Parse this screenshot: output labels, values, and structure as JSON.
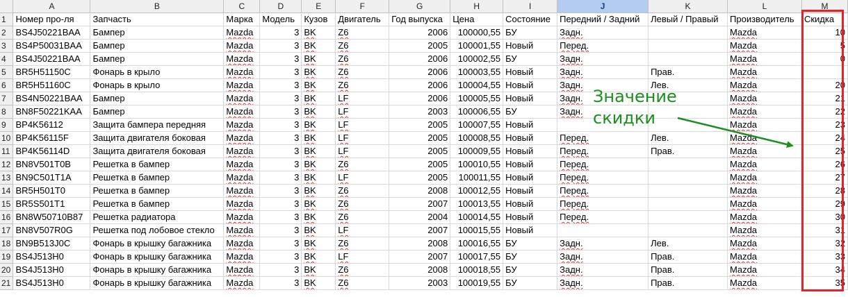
{
  "sheet": {
    "column_letters": [
      "A",
      "B",
      "C",
      "D",
      "E",
      "F",
      "G",
      "H",
      "I",
      "J",
      "K",
      "L",
      "M"
    ],
    "selected_column": "J",
    "headers": [
      "Номер про-ля",
      "Запчасть",
      "Марка",
      "Модель",
      "Кузов",
      "Двигатель",
      "Год выпуска",
      "Цена",
      "Состояние",
      "Передний / Задний",
      "Левый / Правый",
      "Производитель",
      "Скидка"
    ],
    "rows": [
      [
        "BS4J50221BAA",
        "Бампер",
        "Mazda",
        "3",
        "BK",
        "Z6",
        "2006",
        "100000,55",
        "БУ",
        "Задн.",
        "",
        "Mazda",
        "10"
      ],
      [
        "BS4P50031BAA",
        "Бампер",
        "Mazda",
        "3",
        "BK",
        "Z6",
        "2005",
        "100001,55",
        "Новый",
        "Перед.",
        "",
        "Mazda",
        "5"
      ],
      [
        "BS4J50221BAA",
        "Бампер",
        "Mazda",
        "3",
        "BK",
        "Z6",
        "2006",
        "100002,55",
        "БУ",
        "Задн.",
        "",
        "Mazda",
        "0"
      ],
      [
        "BR5H51150C",
        "Фонарь в крыло",
        "Mazda",
        "3",
        "BK",
        "Z6",
        "2006",
        "100003,55",
        "Новый",
        "Задн.",
        "Прав.",
        "Mazda",
        ""
      ],
      [
        "BR5H51160C",
        "Фонарь в крыло",
        "Mazda",
        "3",
        "BK",
        "Z6",
        "2006",
        "100004,55",
        "Новый",
        "Задн.",
        "Лев.",
        "Mazda",
        "20"
      ],
      [
        "BS4N50221BAA",
        "Бампер",
        "Mazda",
        "3",
        "BK",
        "LF",
        "2006",
        "100005,55",
        "Новый",
        "Задн.",
        "",
        "Mazda",
        "21"
      ],
      [
        "BN8F50221KAA",
        "Бампер",
        "Mazda",
        "3",
        "BK",
        "LF",
        "2003",
        "100006,55",
        "БУ",
        "Задн.",
        "",
        "Mazda",
        "22"
      ],
      [
        "BP4K56112",
        "Защита бампера передняя",
        "Mazda",
        "3",
        "BK",
        "LF",
        "2005",
        "100007,55",
        "Новый",
        "",
        "",
        "Mazda",
        "23"
      ],
      [
        "BP4K56115F",
        "Защита двигателя боковая",
        "Mazda",
        "3",
        "BK",
        "LF",
        "2005",
        "100008,55",
        "Новый",
        "Перед.",
        "Лев.",
        "Mazda",
        "24"
      ],
      [
        "BP4K56114D",
        "Защита двигателя боковая",
        "Mazda",
        "3",
        "BK",
        "LF",
        "2005",
        "100009,55",
        "Новый",
        "Перед.",
        "Прав.",
        "Mazda",
        "25"
      ],
      [
        "BN8V501T0B",
        "Решетка в бампер",
        "Mazda",
        "3",
        "BK",
        "Z6",
        "2005",
        "100010,55",
        "Новый",
        "Перед.",
        "",
        "Mazda",
        "26"
      ],
      [
        "BN9C501T1A",
        "Решетка в бампер",
        "Mazda",
        "3",
        "BK",
        "LF",
        "2005",
        "100011,55",
        "Новый",
        "Перед.",
        "",
        "Mazda",
        "27"
      ],
      [
        "BR5H501T0",
        "Решетка в бампер",
        "Mazda",
        "3",
        "BK",
        "Z6",
        "2008",
        "100012,55",
        "Новый",
        "Перед.",
        "",
        "Mazda",
        "28"
      ],
      [
        "BR5S501T1",
        "Решетка в бампер",
        "Mazda",
        "3",
        "BK",
        "Z6",
        "2007",
        "100013,55",
        "Новый",
        "Перед.",
        "",
        "Mazda",
        "29"
      ],
      [
        "BN8W50710B87",
        "Решетка радиатора",
        "Mazda",
        "3",
        "BK",
        "Z6",
        "2004",
        "100014,55",
        "Новый",
        "Перед.",
        "",
        "Mazda",
        "30"
      ],
      [
        "BN8V507R0G",
        "Решетка под лобовое стекло",
        "Mazda",
        "3",
        "BK",
        "LF",
        "2007",
        "100015,55",
        "Новый",
        "",
        "",
        "Mazda",
        "31"
      ],
      [
        "BN9B513J0C",
        "Фонарь в крышку багажника",
        "Mazda",
        "3",
        "BK",
        "Z6",
        "2008",
        "100016,55",
        "БУ",
        "Задн.",
        "Лев.",
        "Mazda",
        "32"
      ],
      [
        "BS4J513H0",
        "Фонарь в крышку багажника",
        "Mazda",
        "3",
        "BK",
        "LF",
        "2007",
        "100017,55",
        "БУ",
        "Задн.",
        "Прав.",
        "Mazda",
        "33"
      ],
      [
        "BS4J513H0",
        "Фонарь в крышку багажника",
        "Mazda",
        "3",
        "BK",
        "Z6",
        "2008",
        "100018,55",
        "БУ",
        "Задн.",
        "Прав.",
        "Mazda",
        "34"
      ],
      [
        "BS4J513H0",
        "Фонарь в крышку багажника",
        "Mazda",
        "3",
        "BK",
        "Z6",
        "2003",
        "100019,55",
        "БУ",
        "Задн.",
        "Прав.",
        "Mazda",
        "35"
      ]
    ]
  },
  "annotation": {
    "text_line1": "Значение",
    "text_line2": "скидки",
    "color": "#1e8f1e"
  },
  "highlight_color": "#e8202a"
}
